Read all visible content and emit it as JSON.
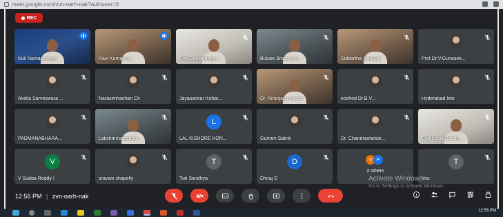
{
  "browser": {
    "url": "meet.google.com/zvn-oarh-nak?authuser=0"
  },
  "meeting": {
    "rec_label": "REC",
    "time": "12:56 PM",
    "separator": "|",
    "code": "zvn-oarh-nak"
  },
  "watermark": {
    "line1": "Activate Windows",
    "line2": "Go to Settings to activate Windows."
  },
  "participants": [
    {
      "name": "Nuli Namassivaya",
      "tile": "video blue",
      "muted": false
    },
    {
      "name": "Ravi Kumar Av...",
      "tile": "video warm",
      "muted": false
    },
    {
      "name": "Prof.Satyanaraya...",
      "tile": "video white",
      "muted": true
    },
    {
      "name": "Buluse Brakshatu...",
      "tile": "video",
      "muted": true
    },
    {
      "name": "Siddartha YakoSai",
      "tile": "video warm",
      "muted": true
    },
    {
      "name": "Prof.Dr.V.Gunasek...",
      "tile": "photo",
      "muted": true
    },
    {
      "name": "Akella Sarveswara ...",
      "tile": "photo",
      "muted": true
    },
    {
      "name": "Narasimhachari Ch",
      "tile": "photo",
      "muted": true
    },
    {
      "name": "Jayasankar Kottar...",
      "tile": "photo",
      "muted": true
    },
    {
      "name": "Dr. Niranjan Prasad",
      "tile": "video warm",
      "muted": true
    },
    {
      "name": "ecehod Dr.B.V...",
      "tile": "photo",
      "muted": true
    },
    {
      "name": "Hyderabad Iete",
      "tile": "photo",
      "muted": true
    },
    {
      "name": "PADMANABHARA...",
      "tile": "photo",
      "muted": true
    },
    {
      "name": "Lakshminarayana...",
      "tile": "video",
      "muted": true
    },
    {
      "name": "LAL KISHORE KON...",
      "tile": "letter",
      "letter": "L",
      "color": "#1a73e8",
      "muted": true
    },
    {
      "name": "Gurram Satvik",
      "tile": "photo",
      "muted": true
    },
    {
      "name": "Dr. Chandrashekar...",
      "tile": "photo",
      "muted": true
    },
    {
      "name": "Prof Linga Reddy ...",
      "tile": "video white",
      "muted": true
    },
    {
      "name": "V Subba Reddy I",
      "tile": "letter",
      "letter": "V",
      "color": "#0b8043",
      "muted": true
    },
    {
      "name": "sravani shapelly",
      "tile": "photo",
      "muted": true
    },
    {
      "name": "Tuti Sandhya",
      "tile": "letter",
      "letter": "T",
      "color": "#5f6368",
      "muted": true
    },
    {
      "name": "Dhiraj D",
      "tile": "letter",
      "letter": "D",
      "color": "#1967d2",
      "muted": true
    },
    {
      "name": "",
      "tile": "two",
      "sub": "2 others",
      "a": "V",
      "b": "P",
      "muted": false
    },
    {
      "name": "You",
      "tile": "letter",
      "letter": "T",
      "color": "#5f6368",
      "muted": true
    }
  ],
  "taskbar": {
    "clock_time": "12:56 PM",
    "clock_date": ""
  }
}
